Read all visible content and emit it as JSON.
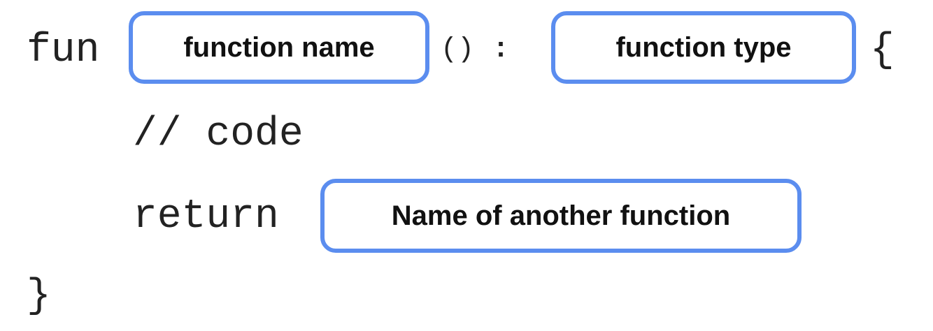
{
  "code": {
    "keyword_fun": "fun",
    "parens": "()",
    "colon": ":",
    "open_brace": "{",
    "comment": "// code",
    "keyword_return": "return",
    "close_brace": "}"
  },
  "placeholders": {
    "function_name": "function name",
    "function_type": "function type",
    "return_value": "Name of another function"
  },
  "colors": {
    "box_border": "#5b8def",
    "code_text": "#222222"
  }
}
